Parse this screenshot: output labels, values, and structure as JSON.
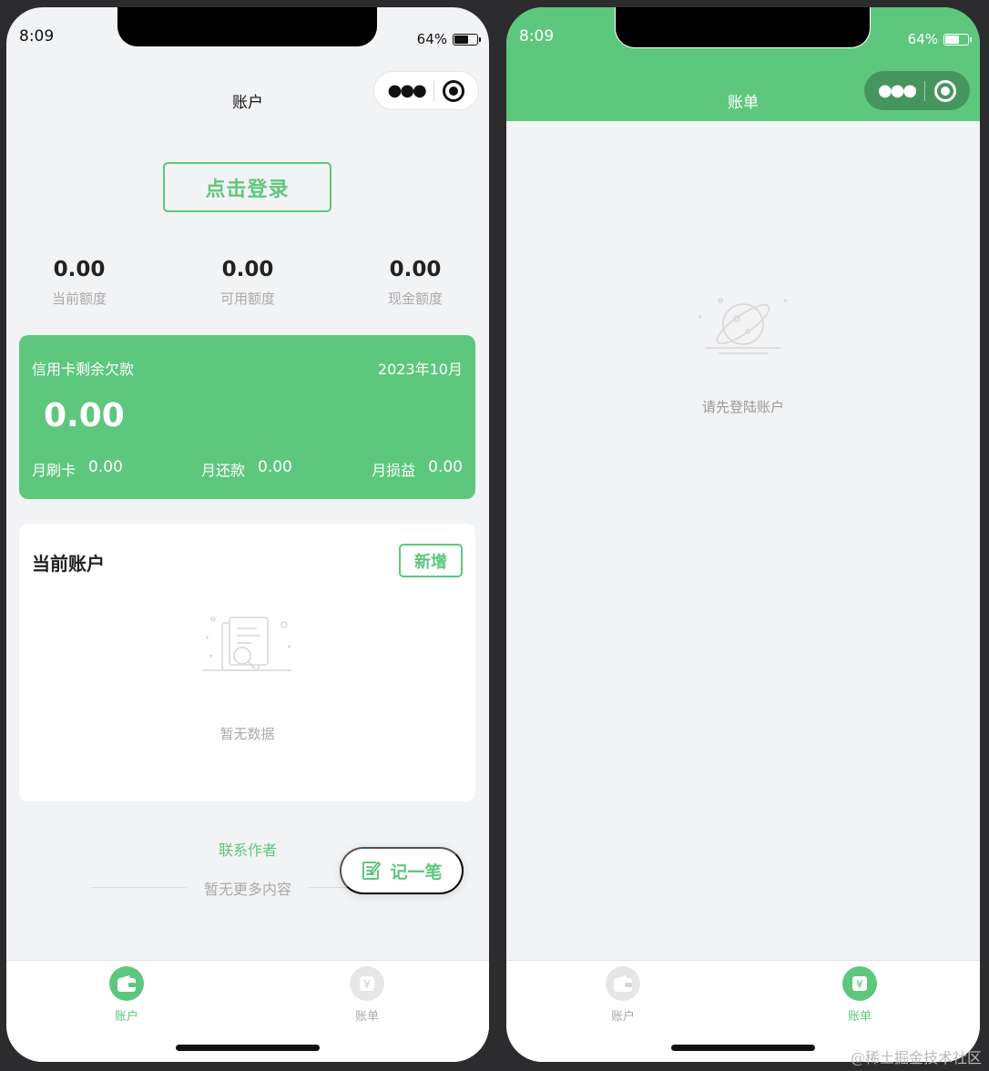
{
  "left": {
    "status": {
      "time": "8:09",
      "battery": "64%",
      "battery_level": 0.64
    },
    "nav": {
      "title": "账户",
      "more_icon": "more-dots-icon",
      "close_icon": "target-circle-icon"
    },
    "login_label": "点击登录",
    "stats": [
      {
        "value": "0.00",
        "label": "当前额度"
      },
      {
        "value": "0.00",
        "label": "可用额度"
      },
      {
        "value": "0.00",
        "label": "现金额度"
      }
    ],
    "credit": {
      "title": "信用卡剩余欠款",
      "date": "2023年10月",
      "amount": "0.00",
      "spend_label": "月刷卡",
      "spend_value": "0.00",
      "repay_label": "月还款",
      "repay_value": "0.00",
      "pl_label": "月损益",
      "pl_value": "0.00"
    },
    "accounts": {
      "title": "当前账户",
      "add_label": "新增",
      "empty_text": "暂无数据"
    },
    "contact_label": "联系作者",
    "no_more_label": "暂无更多内容",
    "fab_label": "记一笔",
    "tabs": [
      {
        "label": "账户",
        "icon": "wallet-icon",
        "active": true
      },
      {
        "label": "账单",
        "icon": "yen-bill-icon",
        "active": false
      }
    ]
  },
  "right": {
    "status": {
      "time": "8:09",
      "battery": "64%",
      "battery_level": 0.64
    },
    "nav": {
      "title": "账单"
    },
    "empty_text": "请先登陆账户",
    "tabs": [
      {
        "label": "账户",
        "icon": "wallet-icon",
        "active": false
      },
      {
        "label": "账单",
        "icon": "yen-bill-icon",
        "active": true
      }
    ]
  },
  "colors": {
    "brand_green": "#5ec77e",
    "background": "#f2f3f5"
  },
  "watermark": "@稀土掘金技术社区"
}
